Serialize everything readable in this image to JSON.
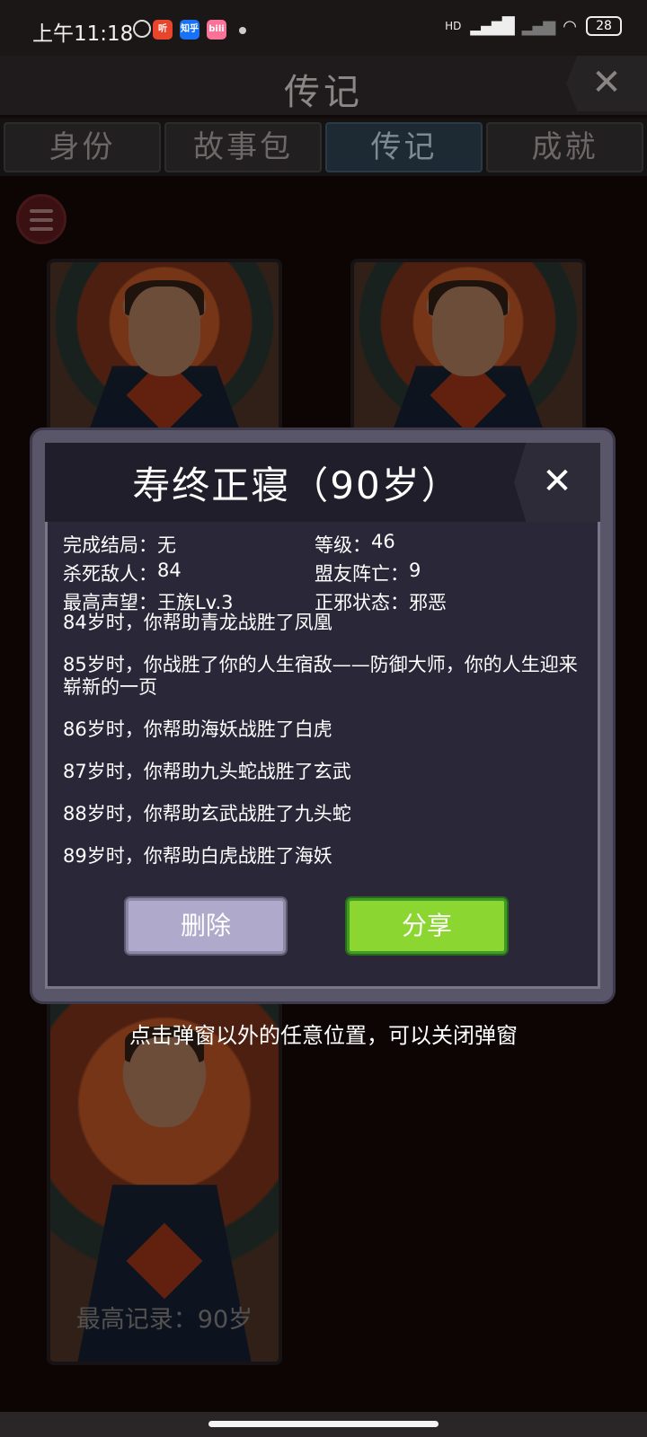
{
  "status_bar": {
    "time": "上午11:18",
    "app_icons": [
      {
        "name": "listen-app-icon",
        "text": "听",
        "color": "#e8452c"
      },
      {
        "name": "zhihu-app-icon",
        "text": "知乎",
        "color": "#1772f6"
      },
      {
        "name": "bilibili-app-icon",
        "text": "bili",
        "color": "#fb7299"
      }
    ],
    "network": "HD",
    "battery": "28"
  },
  "header": {
    "title": "传记",
    "close_icon": "✕"
  },
  "tabs": [
    {
      "label": "身份",
      "active": false
    },
    {
      "label": "故事包",
      "active": false
    },
    {
      "label": "传记",
      "active": true
    },
    {
      "label": "成就",
      "active": false
    }
  ],
  "cards": {
    "bottom_record": "最高记录：90岁"
  },
  "dialog": {
    "title": "寿终正寝（90岁）",
    "close_icon": "✕",
    "stats": [
      {
        "label": "完成结局",
        "value": "无"
      },
      {
        "label": "等级",
        "value": "46"
      },
      {
        "label": "杀死敌人",
        "value": "84"
      },
      {
        "label": "盟友阵亡",
        "value": "9"
      },
      {
        "label": "最高声望",
        "value": "王族Lv.3"
      },
      {
        "label": "正邪状态",
        "value": "邪恶"
      }
    ],
    "log": [
      "84岁时，你帮助青龙战胜了凤凰",
      "85岁时，你战胜了你的人生宿敌——防御大师，你的人生迎来崭新的一页",
      "86岁时，你帮助海妖战胜了白虎",
      "87岁时，你帮助九头蛇战胜了玄武",
      "88岁时，你帮助玄武战胜了九头蛇",
      "89岁时，你帮助白虎战胜了海妖"
    ],
    "delete_label": "删除",
    "share_label": "分享"
  },
  "hint": "点击弹窗以外的任意位置，可以关闭弹窗",
  "colors": {
    "accent_green": "#8bd630",
    "delete_purple": "#afaacc",
    "dialog_bg": "#2a2738"
  }
}
